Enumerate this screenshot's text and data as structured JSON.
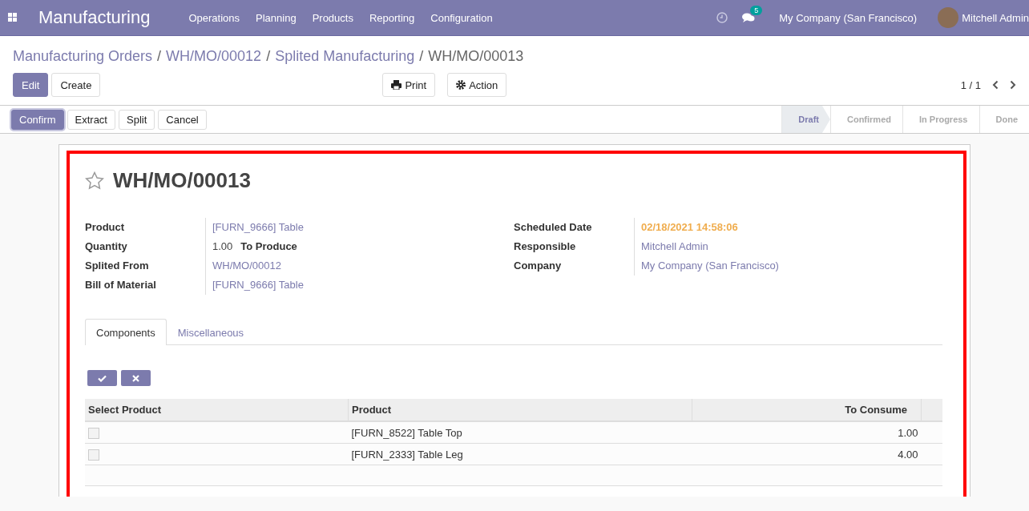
{
  "navbar": {
    "app_title": "Manufacturing",
    "menus": [
      "Operations",
      "Planning",
      "Products",
      "Reporting",
      "Configuration"
    ],
    "messages_count": "5",
    "company": "My Company (San Francisco)",
    "user": "Mitchell Admin"
  },
  "breadcrumb_separator": "/",
  "breadcrumb": [
    {
      "label": "Manufacturing Orders",
      "current": false
    },
    {
      "label": "WH/MO/00012",
      "current": false
    },
    {
      "label": "Splited Manufacturing",
      "current": false
    },
    {
      "label": "WH/MO/00013",
      "current": true
    }
  ],
  "main_buttons": [
    {
      "label": "Edit",
      "primary": true
    },
    {
      "label": "Create",
      "primary": false
    }
  ],
  "print_button": "Print",
  "action_button": "Action",
  "pager": "1 / 1",
  "status_buttons": [
    {
      "label": "Confirm",
      "primary": true
    },
    {
      "label": "Extract",
      "primary": false
    },
    {
      "label": "Split",
      "primary": false
    },
    {
      "label": "Cancel",
      "primary": false
    }
  ],
  "stages": [
    {
      "label": "Draft",
      "selected": true
    },
    {
      "label": "Confirmed",
      "selected": false
    },
    {
      "label": "In Progress",
      "selected": false
    },
    {
      "label": "Done",
      "selected": false
    }
  ],
  "form": {
    "starred": false,
    "title": "WH/MO/00013",
    "left_fields": [
      {
        "label": "Product",
        "value": "[FURN_9666] Table",
        "kind": "link"
      },
      {
        "label": "Quantity",
        "value": "1.00",
        "suffix": "To Produce",
        "kind": "quantity"
      },
      {
        "label": "Splited From",
        "value": "WH/MO/00012",
        "kind": "link"
      },
      {
        "label": "Bill of Material",
        "value": "[FURN_9666] Table",
        "kind": "link"
      }
    ],
    "right_fields": [
      {
        "label": "Scheduled Date",
        "value": "02/18/2021 14:58:06",
        "kind": "warning"
      },
      {
        "label": "Responsible",
        "value": "Mitchell Admin",
        "kind": "link"
      },
      {
        "label": "Company",
        "value": "My Company (San Francisco)",
        "kind": "link"
      }
    ],
    "tabs": [
      {
        "label": "Components",
        "selected": true
      },
      {
        "label": "Miscellaneous",
        "selected": false
      }
    ],
    "table": {
      "columns": [
        "Select Product",
        "Product",
        "To Consume"
      ],
      "rows": [
        {
          "checked": false,
          "product": "[FURN_8522] Table Top",
          "to_consume": "1.00"
        },
        {
          "checked": false,
          "product": "[FURN_2333] Table Leg",
          "to_consume": "4.00"
        }
      ]
    }
  }
}
